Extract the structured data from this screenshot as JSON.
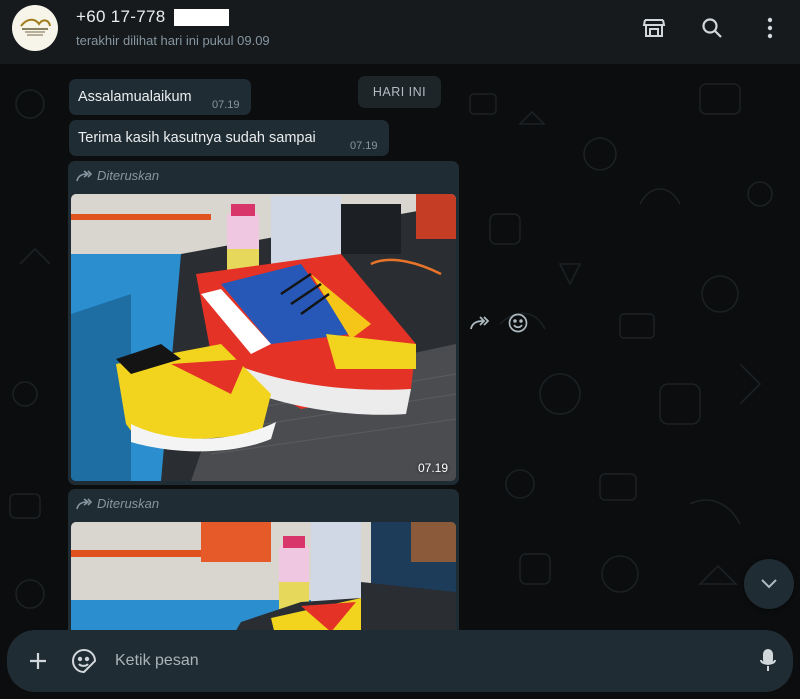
{
  "header": {
    "contact_name": "+60 17-778",
    "status": "terakhir dilihat hari ini pukul 09.09",
    "icons": [
      "catalog-icon",
      "search-icon",
      "menu-icon"
    ]
  },
  "chat": {
    "day_chip": "HARI INI",
    "messages": [
      {
        "text": "Assalamualaikum",
        "time": "07.19"
      },
      {
        "text": "Terima kasih kasutnya sudah sampai",
        "time": "07.19"
      }
    ],
    "forwarded": [
      {
        "label": "Diteruskan",
        "time": "07.19"
      },
      {
        "label": "Diteruskan"
      }
    ]
  },
  "composer": {
    "placeholder": "Ketik pesan"
  },
  "colors": {
    "header_bg": "#161a1d",
    "bubble_bg": "#202c33",
    "chat_bg": "#0b0d0e",
    "secondary_text": "#8696a0"
  }
}
